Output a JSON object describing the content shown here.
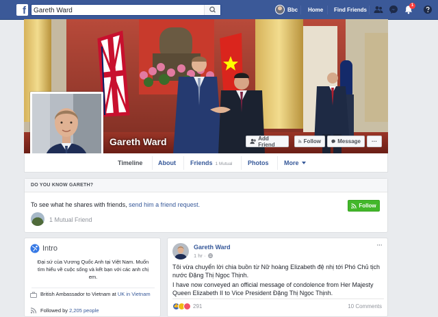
{
  "topbar": {
    "logo": "f",
    "search_value": "Gareth Ward",
    "user_name": "Bbc",
    "home": "Home",
    "find_friends": "Find Friends",
    "notification_count": "1",
    "icons": [
      "search-icon",
      "friend-requests-icon",
      "messenger-icon",
      "notifications-icon",
      "help-icon"
    ]
  },
  "profile": {
    "name": "Gareth Ward",
    "buttons": {
      "add_friend": "Add Friend",
      "follow": "Follow",
      "message": "Message",
      "more": "···"
    },
    "tabs": {
      "timeline": "Timeline",
      "about": "About",
      "friends": "Friends",
      "friends_badge": "1 Mutual",
      "photos": "Photos",
      "more": "More"
    }
  },
  "know": {
    "header": "DO YOU KNOW GARETH?",
    "text_prefix": "To see what he shares with friends,",
    "link": "send him a friend request.",
    "follow": "Follow",
    "mutual": "1 Mutual Friend"
  },
  "intro": {
    "title": "Intro",
    "bio": "Đại sứ của Vương Quốc Anh tại Việt Nam. Muốn tìm hiểu về cuộc sống và kết bạn với các anh chị em.",
    "work_prefix": "British Ambassador to Vietnam at",
    "work_org": "UK in Vietnam",
    "followers_prefix": "Followed by",
    "followers_count": "2,205 people"
  },
  "post": {
    "author": "Gareth Ward",
    "time": "1 hr · ",
    "more": "···",
    "para_vi": "Tôi vừa chuyển lời chia buồn từ Nữ hoàng Elizabeth đệ nhị tới Phó Chủ tịch nước Đặng Thị Ngọc Thịnh.",
    "para_en": "I have now conveyed an official message of condolence from Her Majesty Queen Elizabeth II to Vice President Đặng Thị Ngọc Thịnh.",
    "reaction_count": "291",
    "comments": "10 Comments"
  },
  "colors": {
    "brand": "#3b5998",
    "link": "#365899",
    "follow_green": "#42b72a",
    "notification": "#fa3e3e"
  }
}
